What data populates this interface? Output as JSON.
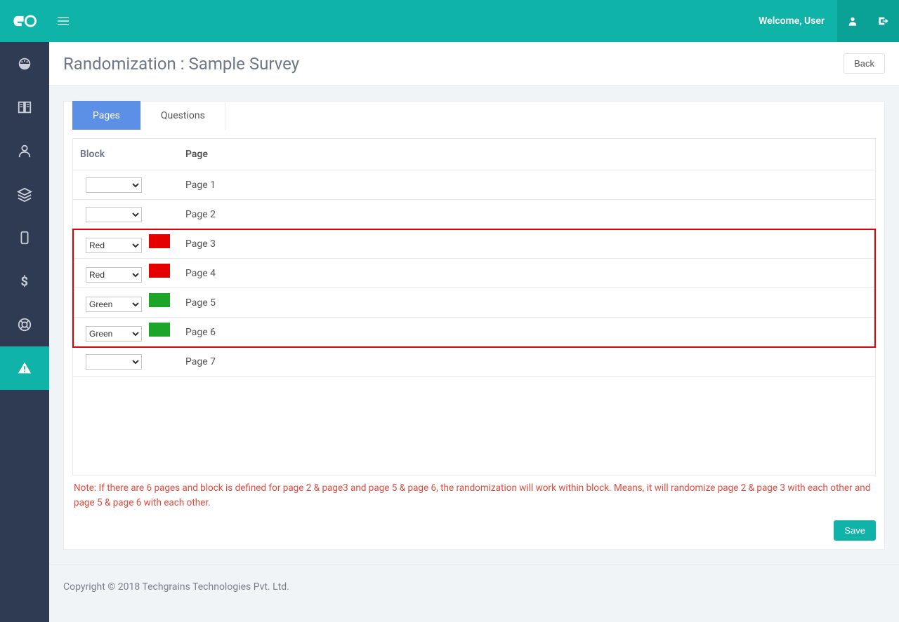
{
  "header": {
    "welcome_text": "Welcome, User"
  },
  "page": {
    "title": "Randomization : Sample Survey",
    "back_button": "Back"
  },
  "tabs": {
    "pages": "Pages",
    "questions": "Questions"
  },
  "grid": {
    "columns": {
      "block": "Block",
      "page": "Page"
    },
    "rows": [
      {
        "block_value": "",
        "swatch": "none",
        "page": "Page 1",
        "highlight": false
      },
      {
        "block_value": "",
        "swatch": "none",
        "page": "Page 2",
        "highlight": false
      },
      {
        "block_value": "Red",
        "swatch": "red",
        "page": "Page 3",
        "highlight": true
      },
      {
        "block_value": "Red",
        "swatch": "red",
        "page": "Page 4",
        "highlight": true
      },
      {
        "block_value": "Green",
        "swatch": "green",
        "page": "Page 5",
        "highlight": true
      },
      {
        "block_value": "Green",
        "swatch": "green",
        "page": "Page 6",
        "highlight": true
      },
      {
        "block_value": "",
        "swatch": "none",
        "page": "Page 7",
        "highlight": false
      }
    ]
  },
  "note": "Note: If there are 6 pages and block is defined for page 2 & page3 and page 5 & page 6, the randomization will work within block. Means, it will randomize page 2 & page 3 with each other and page 5 & page 6 with each other.",
  "actions": {
    "save": "Save"
  },
  "footer": {
    "copyright": "Copyright © 2018 Techgrains Technologies Pvt. Ltd."
  }
}
